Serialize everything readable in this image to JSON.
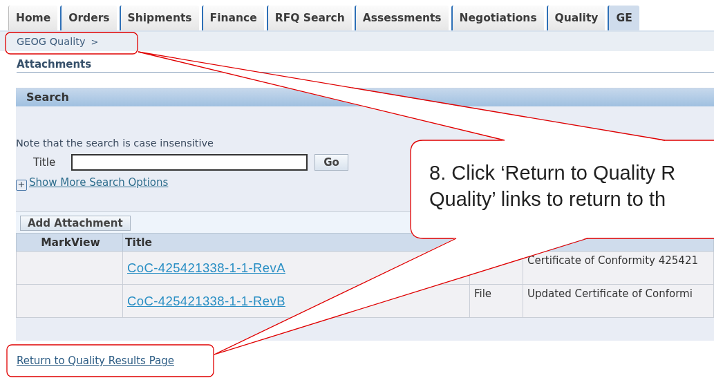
{
  "tabs": [
    {
      "label": "Home",
      "selected": false
    },
    {
      "label": "Orders",
      "selected": false
    },
    {
      "label": "Shipments",
      "selected": false
    },
    {
      "label": "Finance",
      "selected": false
    },
    {
      "label": "RFQ Search",
      "selected": false
    },
    {
      "label": "Assessments",
      "selected": false
    },
    {
      "label": "Negotiations",
      "selected": false
    },
    {
      "label": "Quality",
      "selected": false
    },
    {
      "label": "GE",
      "selected": true
    }
  ],
  "breadcrumb": {
    "link": "GEOG Quality",
    "separator": ">"
  },
  "page_title": "Attachments",
  "search": {
    "header": "Search",
    "note": "Note that the search is case insensitive",
    "field_label": "Title",
    "go_button": "Go",
    "more_toggle": "+",
    "more_link": "Show More Search Options"
  },
  "add_button": "Add Attachment",
  "table": {
    "columns": [
      "MarkView",
      "Title"
    ],
    "rows": [
      {
        "title": "CoC-425421338-1-1-RevA",
        "description": "Certificate of Conformity 425421"
      },
      {
        "title": "CoC-425421338-1-1-RevB",
        "type": "File",
        "description": "Updated Certificate of Conformi"
      }
    ]
  },
  "return_link": "Return to Quality Results Page",
  "callout": {
    "lines": [
      "8. Click ‘Return to Quality R",
      "Quality’ links to return to th"
    ]
  }
}
